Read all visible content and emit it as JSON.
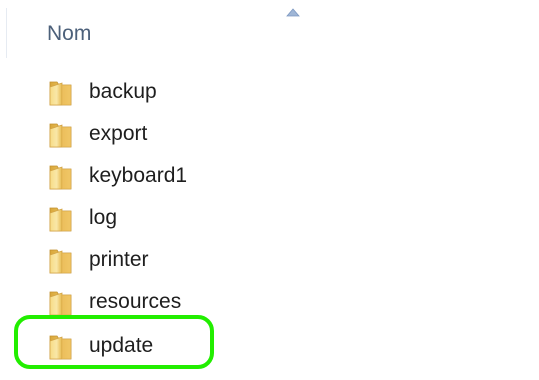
{
  "header": {
    "name_column_label": "Nom",
    "sort_icon": "sort-ascending-icon"
  },
  "files": [
    {
      "name": "backup",
      "icon": "folder-icon"
    },
    {
      "name": "export",
      "icon": "folder-icon"
    },
    {
      "name": "keyboard1",
      "icon": "folder-icon"
    },
    {
      "name": "log",
      "icon": "folder-icon"
    },
    {
      "name": "printer",
      "icon": "folder-icon"
    },
    {
      "name": "resources",
      "icon": "folder-icon"
    },
    {
      "name": "update",
      "icon": "folder-icon"
    }
  ],
  "annotation": {
    "highlight_color": "#22ee00",
    "highlighted_item": "update"
  }
}
